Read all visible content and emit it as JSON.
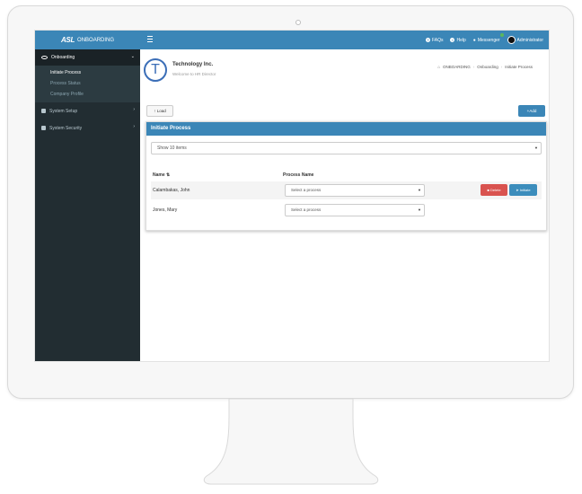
{
  "brand": {
    "logo": "ASL",
    "title": "ONBOARDING"
  },
  "topnav": {
    "faqs": "FAQs",
    "help": "Help",
    "messenger": "Messenger",
    "user": "Administrator"
  },
  "sidebar": {
    "section": "Onboarding",
    "subitems": [
      "Initiate Process",
      "Process Status",
      "Company Profile"
    ],
    "items": [
      "System Setup",
      "System Security"
    ]
  },
  "header": {
    "company": "Technology Inc.",
    "welcome": "Welcome to HR Director",
    "logo_letter": "T"
  },
  "breadcrumb": [
    "ONBOARDING",
    "Onboarding",
    "Initiate Process"
  ],
  "buttons": {
    "load": "Load",
    "add": "Add",
    "delete": "Delete",
    "initiate": "Initiate"
  },
  "panel": {
    "title": "Initiate Process",
    "show_items": "Show 10 items",
    "col_name": "Name",
    "col_process": "Process Name"
  },
  "rows": [
    {
      "name": "Calambakas, John",
      "process": "Select a process"
    },
    {
      "name": "Jones, Mary",
      "process": "Select a process"
    }
  ],
  "colors": {
    "primary": "#3b86b7",
    "sidebar": "#222d32",
    "danger": "#d9534f"
  }
}
